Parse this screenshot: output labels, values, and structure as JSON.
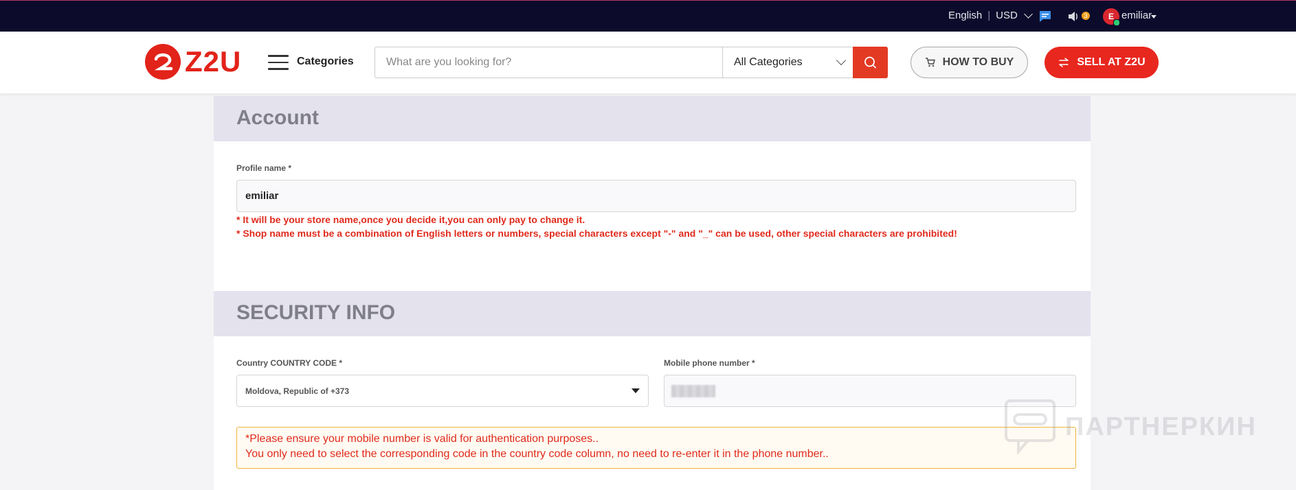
{
  "topbar": {
    "language": "English",
    "currency": "USD",
    "notification_count": "3",
    "avatar_initial": "E",
    "username": "emiliar"
  },
  "header": {
    "logo_text": "Z2U",
    "categories_label": "Categories",
    "search_placeholder": "What are you looking for?",
    "category_select": "All Categories",
    "how_to_buy": "HOW TO BUY",
    "sell_label": "SELL AT Z2U"
  },
  "account": {
    "title": "Account",
    "profile_label": "Profile name",
    "required_mark": "*",
    "profile_value": "emiliar",
    "error1": "* It will be your store name,once you decide it,you can only pay to change it.",
    "error2": "* Shop name must be a combination of English letters or numbers, special characters except \"-\" and \"_\" can be used, other special characters are prohibited!"
  },
  "security": {
    "title": "SECURITY INFO",
    "country_label": "Country COUNTRY CODE",
    "country_value": "Moldova, Republic of +373",
    "phone_label": "Mobile phone number",
    "notice_line1": "*Please ensure your mobile number is valid for authentication purposes..",
    "notice_line2": "You only need to select the corresponding code in the country code column, no need to re-enter it in the phone number.."
  },
  "watermark": {
    "text": "ПАРТНЕРКИН"
  },
  "colors": {
    "accent": "#e33a24",
    "topbar": "#0c0b2b",
    "error": "#e02a1c"
  }
}
